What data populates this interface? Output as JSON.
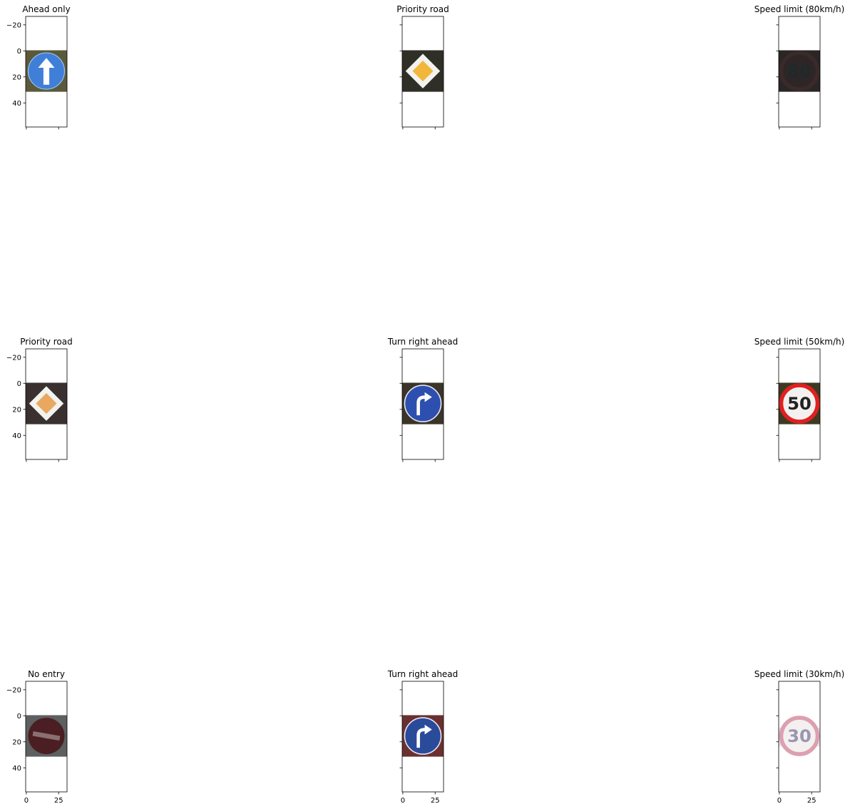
{
  "chart_data": {
    "type": "image-grid",
    "rows": 3,
    "cols": 3,
    "x_ticks": [
      0,
      25
    ],
    "y_ticks": [
      -20,
      0,
      20,
      40
    ],
    "xlim": [
      -0.5,
      31.5
    ],
    "ylim": [
      -26.5,
      58.5
    ],
    "image_extent": {
      "x": [
        -0.5,
        31.5
      ],
      "y": [
        -0.5,
        31.5
      ]
    },
    "shared_x": true,
    "shared_y": true,
    "panels": [
      {
        "title": "Ahead only",
        "sign": "ahead-only",
        "bg": "#5a5a3a",
        "sign_color": "#3f7fd8"
      },
      {
        "title": "Priority road",
        "sign": "priority",
        "bg": "#2f2f28",
        "sign_color": "#f2b73a"
      },
      {
        "title": "Speed limit (80km/h)",
        "sign": "speed-dark",
        "bg": "#2a2626",
        "sign_color": "#3a2a2a",
        "speed": "80"
      },
      {
        "title": "Priority road",
        "sign": "priority",
        "bg": "#3a3030",
        "sign_color": "#e8a860"
      },
      {
        "title": "Turn right ahead",
        "sign": "turn-right",
        "bg": "#3a3528",
        "sign_color": "#2d4fb0"
      },
      {
        "title": "Speed limit (50km/h)",
        "sign": "speed",
        "bg": "#3e3a22",
        "sign_color": "#e02020",
        "speed": "50"
      },
      {
        "title": "No entry",
        "sign": "no-entry",
        "bg": "#5c6060",
        "sign_color": "#4a1e22"
      },
      {
        "title": "Turn right ahead",
        "sign": "turn-right",
        "bg": "#6a3030",
        "sign_color": "#2a4a9a"
      },
      {
        "title": "Speed limit (30km/h)",
        "sign": "speed-faded",
        "bg": "#ffffff",
        "sign_color": "#dca0b0",
        "speed": "30"
      }
    ]
  }
}
